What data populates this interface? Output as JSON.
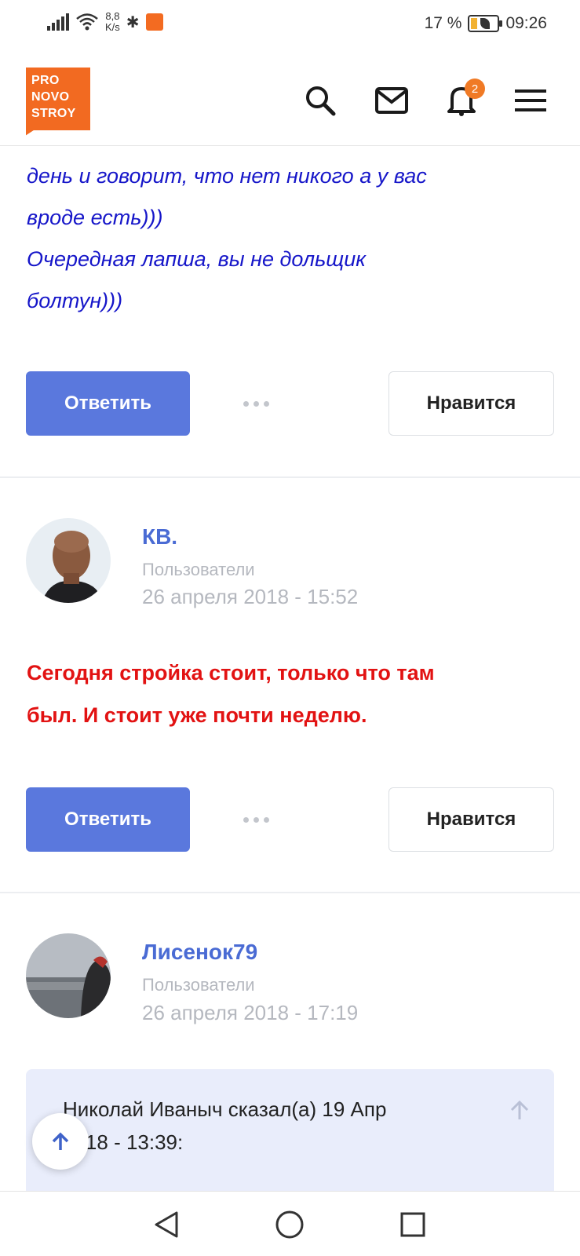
{
  "status_bar": {
    "net_speed_value": "8,8",
    "net_speed_unit": "K/s",
    "battery": "17 %",
    "time": "09:26"
  },
  "header": {
    "logo_lines": [
      "PRO",
      "NOVO",
      "STROY"
    ],
    "notifications_count": "2"
  },
  "posts": [
    {
      "text_lines": [
        "день и говорит, что  нет никого а у вас",
        "вроде есть)))",
        "Очередная лапша, вы не дольщик",
        "болтун)))"
      ],
      "reply_label": "Ответить",
      "like_label": "Нравится"
    },
    {
      "author": "КВ.",
      "group": "Пользователи",
      "date": "26 апреля 2018 - 15:52",
      "text_lines": [
        "Сегодня стройка стоит, только что там",
        "был. И стоит уже почти неделю."
      ],
      "reply_label": "Ответить",
      "like_label": "Нравится"
    },
    {
      "author": "Лисенок79",
      "group": "Пользователи",
      "date": "26 апреля 2018 - 17:19",
      "quote_head_lines": [
        "Николай Иваныч сказал(а) 19 Апр",
        "2018 - 13:39:"
      ]
    }
  ],
  "colors": {
    "brand_orange": "#f26a21",
    "button_blue": "#5a78dd",
    "author_blue": "#4a6bd4",
    "quote_blue_text": "#1616c9",
    "alert_red_text": "#e21212"
  }
}
